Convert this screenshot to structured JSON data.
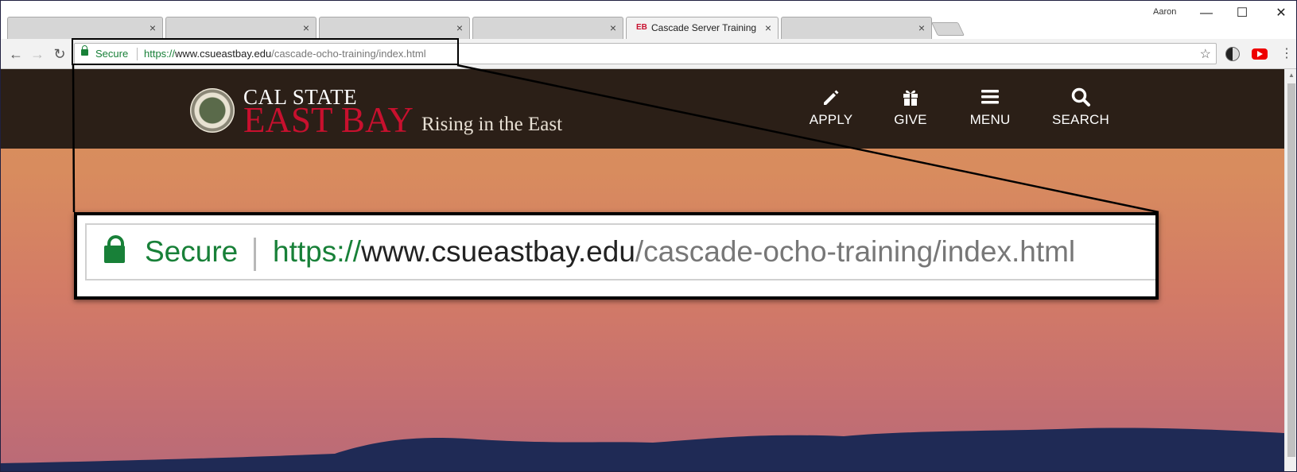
{
  "window": {
    "profile_name": "Aaron",
    "minimize_glyph": "—",
    "maximize_glyph": "☐",
    "close_glyph": "✕"
  },
  "tabs": [
    {
      "title": "",
      "close": "×",
      "active": false
    },
    {
      "title": "",
      "close": "×",
      "active": false
    },
    {
      "title": "",
      "close": "×",
      "active": false
    },
    {
      "title": "",
      "close": "×",
      "active": false
    },
    {
      "title": "Cascade Server Training",
      "favicon_text": "EB",
      "close": "×",
      "active": true
    },
    {
      "title": "",
      "close": "×",
      "active": false
    }
  ],
  "toolbar": {
    "back_glyph": "←",
    "forward_glyph": "→",
    "reload_glyph": "↻",
    "secure_label": "Secure",
    "url_scheme": "https://",
    "url_host": "www.csueastbay.edu",
    "url_path": "/cascade-ocho-training/index.html",
    "star_glyph": "☆",
    "menu_glyph": "⋮",
    "extensions": [
      "dark-mode-extension-icon",
      "youtube-extension-icon"
    ]
  },
  "site": {
    "brand_top": "CAL STATE",
    "brand_main": "EAST BAY",
    "tagline": "Rising in the East",
    "nav": [
      {
        "label": "APPLY",
        "icon": "pencil-icon"
      },
      {
        "label": "GIVE",
        "icon": "gift-icon"
      },
      {
        "label": "MENU",
        "icon": "hamburger-menu-icon"
      },
      {
        "label": "SEARCH",
        "icon": "search-icon"
      }
    ],
    "colors": {
      "header_bg": "#2b1f17",
      "brand_red": "#c8102e"
    }
  },
  "zoom_callout": {
    "secure_label": "Secure",
    "url_scheme": "https://",
    "url_host": "www.csueastbay.edu",
    "url_path": "/cascade-ocho-training/index.html"
  },
  "colors": {
    "secure_green": "#188038",
    "sunset_top": "#d9915a",
    "sunset_bottom": "#b96a78",
    "hills": "#1f2a55"
  }
}
